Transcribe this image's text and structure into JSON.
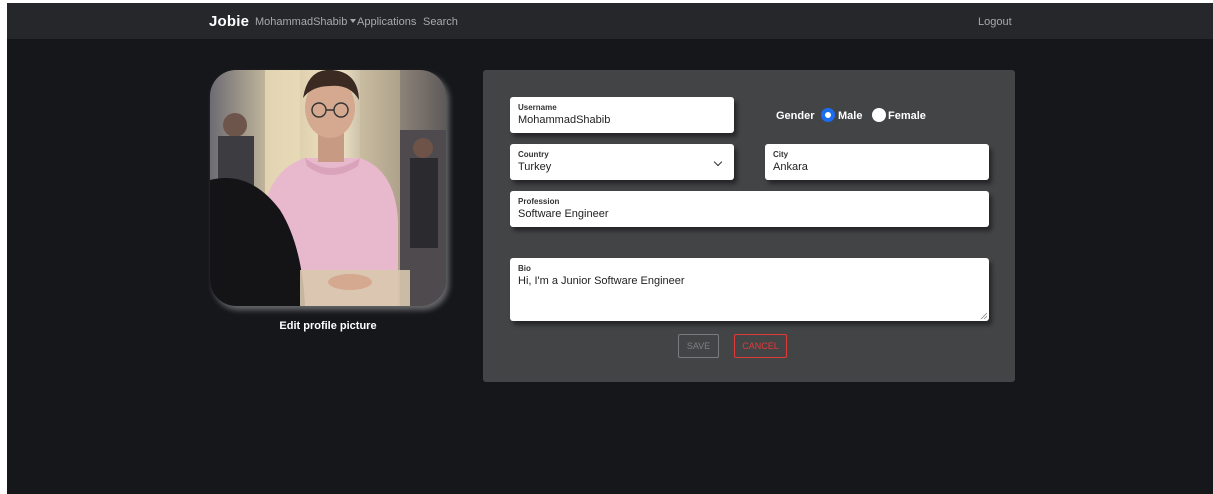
{
  "nav": {
    "brand": "Jobie",
    "user_menu": "MohammadShabib",
    "applications": "Applications",
    "search": "Search",
    "logout": "Logout"
  },
  "profile": {
    "edit_picture": "Edit profile picture"
  },
  "form": {
    "username": {
      "label": "Username",
      "value": "MohammadShabib"
    },
    "gender": {
      "label": "Gender",
      "options": [
        "Male",
        "Female"
      ],
      "selected": "Male"
    },
    "country": {
      "label": "Country",
      "value": "Turkey"
    },
    "city": {
      "label": "City",
      "value": "Ankara"
    },
    "profession": {
      "label": "Profession",
      "value": "Software Engineer"
    },
    "bio": {
      "label": "Bio",
      "value": "Hi, I'm a Junior Software Engineer"
    },
    "save_label": "SAVE",
    "cancel_label": "CANCEL"
  },
  "colors": {
    "background": "#16171b",
    "navbar": "#26272b",
    "card": "#434446",
    "radio_accent": "#1a6df0",
    "cancel": "#e23a3a"
  }
}
